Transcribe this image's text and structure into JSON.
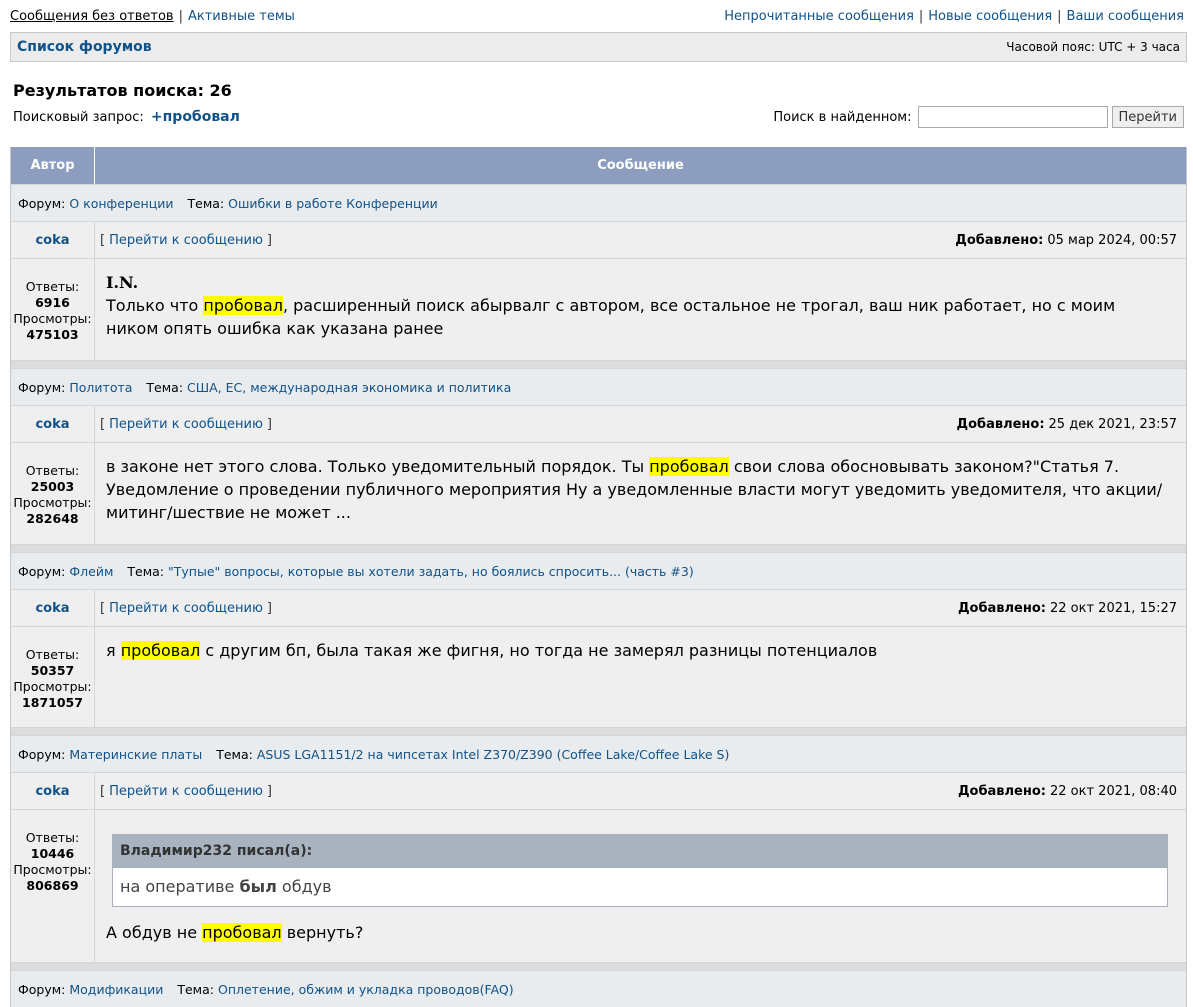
{
  "topnav": {
    "left": [
      "Сообщения без ответов",
      "Активные темы"
    ],
    "right": [
      "Непрочитанные сообщения",
      "Новые сообщения",
      "Ваши сообщения"
    ]
  },
  "navbar": {
    "forums_label": "Список форумов",
    "timezone": "Часовой пояс: UTC + 3 часа"
  },
  "search": {
    "results_label": "Результатов поиска: 26",
    "query_label": "Поисковый запрос:",
    "query_term": "+пробовал",
    "within_label": "Поиск в найденном:",
    "within_value": "",
    "go_label": "Перейти"
  },
  "table": {
    "col_author": "Автор",
    "col_message": "Сообщение",
    "forum_label": "Форум:",
    "topic_label": "Тема:",
    "jump_label": "Перейти к сообщению",
    "added_label": "Добавлено:",
    "replies_label": "Ответы:",
    "views_label": "Просмотры:"
  },
  "posts": [
    {
      "forum": "О конференции",
      "topic": "Ошибки в работе Конференции",
      "author": "coka",
      "date": "05 мар 2024, 00:57",
      "replies": "6916",
      "views": "475103",
      "title": "I.N.",
      "before": "Только что ",
      "hl": "пробовал",
      "after": ", расширенный поиск абырвалг с автором, все остальное не трогал, ваш ник работает, но с моим ником опять ошибка как указана ранее"
    },
    {
      "forum": "Политота",
      "topic": "США, ЕС, международная экономика и политика",
      "author": "coka",
      "date": "25 дек 2021, 23:57",
      "replies": "25003",
      "views": "282648",
      "before": "в законе нет этого слова. Только уведомительный порядок. Ты ",
      "hl": "пробовал",
      "after": " свои слова обосновывать законом?\"Статья 7. Уведомление о проведении публичного мероприятия Ну а уведомленные власти могут уведомить уведомителя, что акции/митинг/шествие не может ..."
    },
    {
      "forum": "Флейм",
      "topic": "\"Тупые\" вопросы, которые вы хотели задать, но боялись спросить... (часть #3)",
      "author": "coka",
      "date": "22 окт 2021, 15:27",
      "replies": "50357",
      "views": "1871057",
      "before": "я ",
      "hl": "пробовал",
      "after": " с другим бп, была такая же фигня, но тогда не замерял разницы потенциалов"
    },
    {
      "forum": "Материнские платы",
      "topic": "ASUS LGA1151/2 на чипсетах Intel Z370/Z390 (Coffee Lake/Coffee Lake S)",
      "author": "coka",
      "date": "22 окт 2021, 08:40",
      "replies": "10446",
      "views": "806869",
      "quote_author": "Владимир232 писал(а):",
      "quote_before": "на оперативе ",
      "quote_bold": "был",
      "quote_after": " обдув",
      "before": "А обдув не ",
      "hl": "пробовал",
      "after": " вернуть?"
    },
    {
      "forum": "Модификации",
      "topic": "Оплетение, обжим и укладка проводов(FAQ)"
    }
  ]
}
